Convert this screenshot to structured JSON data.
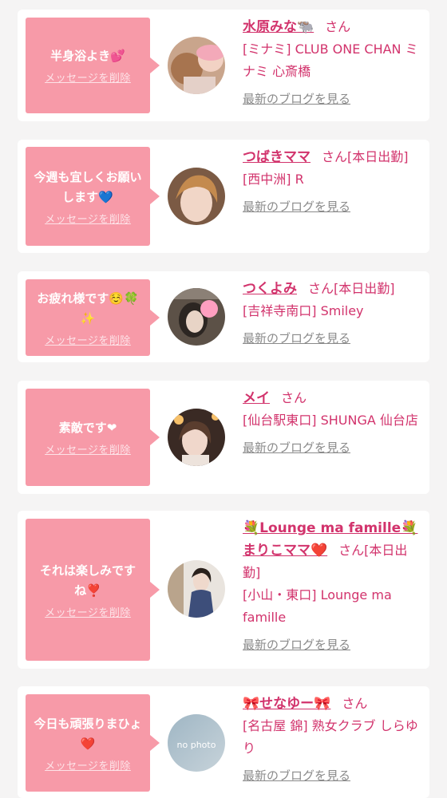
{
  "list": {
    "items": [
      {
        "message": "半身浴よき💕",
        "delete_label": "メッセージを削除",
        "name": "水原みな🐃",
        "san": "さん",
        "shop": "[ミナミ] CLUB ONE CHAN ミナミ 心斎橋",
        "blog_label": "最新のブログを見る"
      },
      {
        "message": "今週も宜しくお願いします💙",
        "delete_label": "メッセージを削除",
        "name": "つばきママ",
        "san": "さん[本日出勤]",
        "shop": "[西中洲] R",
        "blog_label": "最新のブログを見る"
      },
      {
        "message": "お疲れ様です☺️🍀✨",
        "delete_label": "メッセージを削除",
        "name": "つくよみ",
        "san": "さん[本日出勤]",
        "shop": "[吉祥寺南口] Smiley",
        "blog_label": "最新のブログを見る"
      },
      {
        "message": "素敵です❤",
        "delete_label": "メッセージを削除",
        "name": "メイ",
        "san": "さん",
        "shop": "[仙台駅東口] SHUNGA 仙台店",
        "blog_label": "最新のブログを見る"
      },
      {
        "message": "それは楽しみですね❣️",
        "delete_label": "メッセージを削除",
        "name_prefix": "💐Lounge ma famille💐",
        "name": "まりこママ❤️",
        "san": "さん[本日出勤]",
        "shop": "[小山・東口] Lounge ma famille",
        "blog_label": "最新のブログを見る"
      },
      {
        "message": "今日も頑張りまひょ❤️",
        "delete_label": "メッセージを削除",
        "name": "🎀せなゆー🎀",
        "san": "さん",
        "shop": "[名古屋 錦] 熟女クラブ しらゆり",
        "avatar_text": "no photo",
        "blog_label": "最新のブログを見る"
      }
    ]
  }
}
